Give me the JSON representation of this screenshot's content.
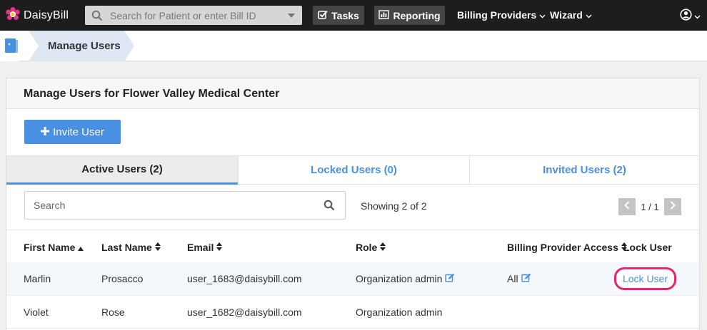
{
  "nav": {
    "brand": "DaisyBill",
    "search_placeholder": "Search for Patient or enter Bill ID",
    "tasks": "Tasks",
    "reporting": "Reporting",
    "billing_providers": "Billing Providers",
    "wizard": "Wizard"
  },
  "breadcrumb": {
    "current": "Manage Users"
  },
  "panel": {
    "title": "Manage Users for Flower Valley Medical Center",
    "invite_button": "Invite User"
  },
  "tabs": [
    {
      "label": "Active Users (2)",
      "active": true
    },
    {
      "label": "Locked Users (0)",
      "active": false
    },
    {
      "label": "Invited Users (2)",
      "active": false
    }
  ],
  "table_search": {
    "placeholder": "Search"
  },
  "showing": "Showing 2 of 2",
  "pager": {
    "page": "1 / 1"
  },
  "table": {
    "columns": [
      "First Name",
      "Last Name",
      "Email",
      "Role",
      "Billing Provider Access",
      "Lock User"
    ],
    "rows": [
      {
        "first": "Marlin",
        "last": "Prosacco",
        "email": "user_1683@daisybill.com",
        "role": "Organization admin",
        "access": "All",
        "lock": "Lock User"
      },
      {
        "first": "Violet",
        "last": "Rose",
        "email": "user_1682@daisybill.com",
        "role": "Organization admin",
        "access": "",
        "lock": ""
      }
    ]
  },
  "colors": {
    "accent": "#4a90e2",
    "highlight": "#e8256d",
    "nav_bg": "#1d1d1d"
  }
}
